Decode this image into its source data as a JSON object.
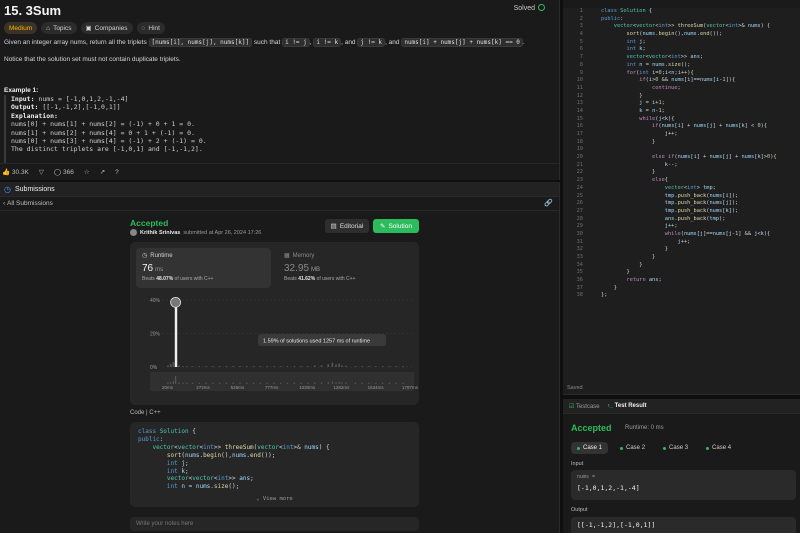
{
  "problem": {
    "title": "15. 3Sum",
    "status": "Solved",
    "tags": {
      "difficulty": "Medium",
      "topics": "Topics",
      "companies": "Companies",
      "hint": "Hint"
    },
    "desc_1a": "Given an integer array nums, return all the triplets",
    "desc_code1": "[nums[i], nums[j], nums[k]]",
    "desc_1b": "such that",
    "desc_code2": "i != j",
    "desc_code3": "i != k",
    "desc_and": ", and",
    "desc_code4": "j != k",
    "desc_code5": "nums[i] + nums[j] + nums[k] == 0",
    "desc_2": "Notice that the solution set must not contain duplicate triplets.",
    "example_title": "Example 1:",
    "example_input_label": "Input:",
    "example_input": "nums = [-1,0,1,2,-1,-4]",
    "example_output_label": "Output:",
    "example_output": "[[-1,-1,2],[-1,0,1]]",
    "example_expl_label": "Explanation:",
    "example_lines": [
      "nums[0] + nums[1] + nums[2] = (-1) + 0 + 1 = 0.",
      "nums[1] + nums[2] + nums[4] = 0 + 1 + (-1) = 0.",
      "nums[0] + nums[3] + nums[4] = (-1) + 2 + (-1) = 0.",
      "The distinct triplets are [-1,0,1] and [-1,-1,2]."
    ],
    "likes": "30.3K",
    "comments": "366"
  },
  "submissions": {
    "header": "Submissions",
    "back_label": "All Submissions",
    "result": "Accepted",
    "author": "Krithik Srinivas",
    "submitted_at": "submitted at Apr 26, 2024 17:26",
    "editorial_btn": "Editorial",
    "solution_btn": "Solution",
    "runtime_label": "Runtime",
    "runtime_value": "76",
    "runtime_unit": "ms",
    "runtime_beats_pre": "Beats",
    "runtime_beats": "48.07%",
    "runtime_beats_post": "of users with C++",
    "memory_label": "Memory",
    "memory_value": "32.95",
    "memory_unit": "MB",
    "memory_beats_pre": "Beats",
    "memory_beats": "41.62%",
    "memory_beats_post": "of users with C++",
    "tooltip": "1.59% of solutions used 1257 ms of runtime",
    "code_lang_label": "Code",
    "code_lang": "C++",
    "view_more": "View more",
    "notes_placeholder": "Write your notes here"
  },
  "chart_data": {
    "type": "bar",
    "title": "",
    "xlabel": "",
    "ylabel": "",
    "y_ticks": [
      "40%",
      "20%",
      "0%"
    ],
    "ylim": [
      0,
      40
    ],
    "x_ticks": [
      "20ms",
      "272ms",
      "525ms",
      "777ms",
      "1030ms",
      "1282ms",
      "1534ms",
      "1787ms"
    ],
    "x_range": [
      20,
      1787
    ],
    "highlight_x": 76,
    "values_x": [
      20,
      40,
      60,
      76,
      100,
      130,
      160,
      200,
      250,
      300,
      350,
      400,
      450,
      500,
      550,
      600,
      650,
      700,
      750,
      800,
      850,
      900,
      950,
      1000,
      1050,
      1100,
      1150,
      1200,
      1230,
      1257,
      1280,
      1300,
      1330,
      1400,
      1450,
      1500,
      1550,
      1600,
      1650,
      1700,
      1750
    ],
    "values_y": [
      1,
      2,
      3,
      38,
      1,
      0.5,
      0.5,
      0.5,
      0.5,
      0.5,
      0.5,
      0.5,
      0.5,
      0.5,
      0.5,
      0.5,
      0.5,
      0.5,
      0.5,
      0.5,
      0.5,
      0.5,
      0.5,
      0.5,
      0.5,
      0.8,
      1,
      1.6,
      2.5,
      1.59,
      2,
      1,
      0.8,
      0.5,
      0.5,
      0.5,
      0.5,
      0.5,
      0.5,
      0.5,
      0.5
    ]
  },
  "snippet": [
    "class Solution {",
    "public:",
    "    vector<vector<int>> threeSum(vector<int>& nums) {",
    "        sort(nums.begin(),nums.end());",
    "        int j;",
    "        int k;",
    "        vector<vector<int>> ans;",
    "        int n = nums.size();"
  ],
  "editor": {
    "lines": [
      "class Solution {",
      "public:",
      "    vector<vector<int>> threeSum(vector<int>& nums) {",
      "        sort(nums.begin(),nums.end());",
      "        int j;",
      "        int k;",
      "        vector<vector<int>> ans;",
      "        int n = nums.size();",
      "        for(int i=0;i<n;i++){",
      "            if(i>0 && nums[i]==nums[i-1]){",
      "                continue;",
      "            }",
      "            j = i+1;",
      "            k = n-1;",
      "            while(j<k){",
      "                if(nums[i] + nums[j] + nums[k] < 0){",
      "                    j++;",
      "                }",
      "",
      "                else if(nums[i] + nums[j] + nums[k]>0){",
      "                    k--;",
      "                }",
      "                else{",
      "                    vector<int> tmp;",
      "                    tmp.push_back(nums[i]);",
      "                    tmp.push_back(nums[j]);",
      "                    tmp.push_back(nums[k]);",
      "                    ans.push_back(tmp);",
      "                    j++;",
      "                    while(nums[j]==nums[j-1] && j<k){",
      "                        j++;",
      "                    }",
      "                }",
      "            }",
      "        }",
      "        return ans;",
      "    }",
      "};"
    ],
    "saved": "Saved"
  },
  "result": {
    "tab_testcase": "Testcase",
    "tab_result": "Test Result",
    "status": "Accepted",
    "runtime": "Runtime: 0 ms",
    "cases": [
      "Case 1",
      "Case 2",
      "Case 3",
      "Case 4"
    ],
    "input_label": "Input",
    "input_key": "nums =",
    "input_value": "[-1,0,1,2,-1,-4]",
    "output_label": "Output",
    "output_value": "[[-1,-1,2],[-1,0,1]]"
  },
  "colors": {
    "accent_green": "#2cbb5d",
    "medium": "#ffb800",
    "blue": "#4c8ef7"
  }
}
